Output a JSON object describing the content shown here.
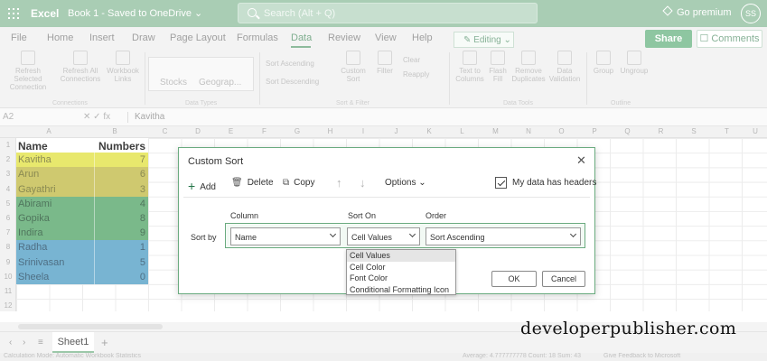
{
  "titlebar": {
    "app_name": "Excel",
    "doc_title": "Book 1 - Saved to OneDrive ⌄",
    "search_placeholder": "Search (Alt + Q)",
    "premium": "Go premium",
    "avatar_initials": "SS"
  },
  "menu": {
    "tabs": [
      "File",
      "Home",
      "Insert",
      "Draw",
      "Page Layout",
      "Formulas",
      "Data",
      "Review",
      "View",
      "Help"
    ],
    "active_tab": "Data",
    "editing": "✎ Editing ⌄",
    "share": "Share",
    "comments": "☐ Comments"
  },
  "ribbon": {
    "buttons": [
      "Refresh Selected Connection",
      "Refresh All Connections",
      "Workbook Links",
      "Stocks",
      "Geograp...",
      "Sort Ascending",
      "Sort Descending",
      "Custom Sort",
      "Filter",
      "Clear",
      "Reapply",
      "Text to Columns",
      "Flash Fill",
      "Remove Duplicates",
      "Data Validation",
      "Group",
      "Ungroup"
    ],
    "groups": [
      "Connections",
      "Data Types",
      "Sort & Filter",
      "Data Tools",
      "Outline"
    ]
  },
  "formula_bar": {
    "name_box": "A2",
    "fx": "✕   ✓   fx",
    "value": "Kavitha"
  },
  "sheet": {
    "columns": [
      "A",
      "B",
      "C",
      "D",
      "E",
      "F",
      "G",
      "H",
      "I",
      "J",
      "K",
      "L",
      "M",
      "N",
      "O",
      "P",
      "Q",
      "R",
      "S",
      "T",
      "U"
    ],
    "rows": [
      "1",
      "2",
      "3",
      "4",
      "5",
      "6",
      "7",
      "8",
      "9",
      "10",
      "11",
      "12"
    ],
    "header": {
      "name": "Name",
      "numbers": "Numbers"
    },
    "data": [
      {
        "name": "Kavitha",
        "value": "7",
        "color": "#e8e86d"
      },
      {
        "name": "Arun",
        "value": "6",
        "color": "#cfc96f"
      },
      {
        "name": "Gayathri",
        "value": "3",
        "color": "#cfc96f"
      },
      {
        "name": "Abirami",
        "value": "4",
        "color": "#7ab98a"
      },
      {
        "name": "Gopika",
        "value": "8",
        "color": "#7ab98a"
      },
      {
        "name": "Indira",
        "value": "9",
        "color": "#7ab98a"
      },
      {
        "name": "Radha",
        "value": "1",
        "color": "#78b4d2"
      },
      {
        "name": "Srinivasan",
        "value": "5",
        "color": "#78b4d2"
      },
      {
        "name": "Sheela",
        "value": "0",
        "color": "#78b4d2"
      }
    ],
    "sheet_tab": "Sheet1",
    "add_sheet": "+"
  },
  "statusbar": {
    "left": "Calculation Mode: Automatic   Workbook Statistics",
    "middle": "Average: 4.777777778   Count: 18   Sum: 43",
    "right": "Give Feedback to Microsoft"
  },
  "dialog": {
    "title": "Custom Sort",
    "close": "✕",
    "add": "Add",
    "delete": "Delete",
    "copy": "Copy",
    "options": "Options ⌄",
    "headers_checkbox": "My data has headers",
    "headers_checked": true,
    "col_column": "Column",
    "col_sort_on": "Sort On",
    "col_order": "Order",
    "sort_by": "Sort by",
    "column_value": "Name",
    "sort_on_value": "Cell Values",
    "order_value": "Sort Ascending",
    "sort_on_options": [
      "Cell Values",
      "Cell Color",
      "Font Color",
      "Conditional Formatting Icon"
    ],
    "ok": "OK",
    "cancel": "Cancel"
  },
  "watermark": "developerpublisher.com",
  "colors": {
    "accent": "#217346",
    "dialog_border": "#6aab7f",
    "titlebar": "#a9cdb4"
  }
}
